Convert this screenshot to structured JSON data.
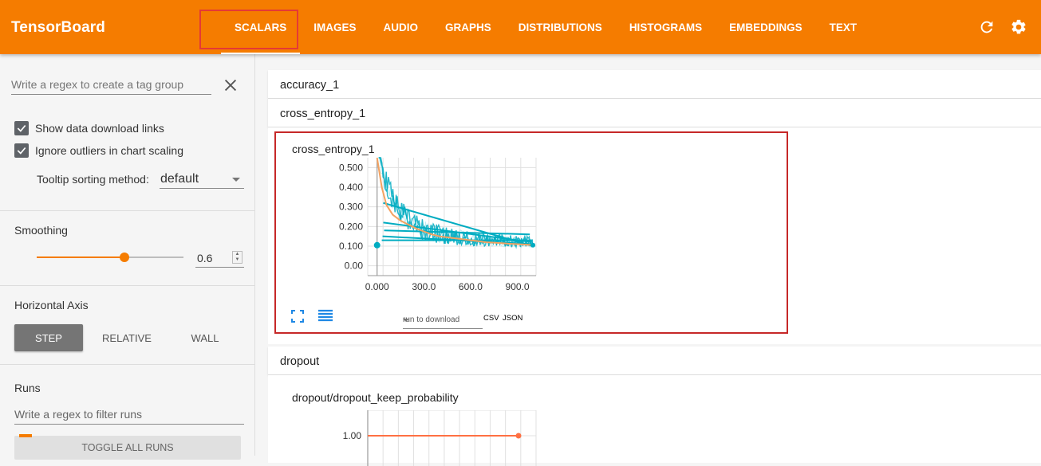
{
  "app": {
    "title": "TensorBoard"
  },
  "tabs": [
    {
      "label": "SCALARS",
      "active": true
    },
    {
      "label": "IMAGES"
    },
    {
      "label": "AUDIO"
    },
    {
      "label": "GRAPHS"
    },
    {
      "label": "DISTRIBUTIONS"
    },
    {
      "label": "HISTOGRAMS"
    },
    {
      "label": "EMBEDDINGS"
    },
    {
      "label": "TEXT"
    }
  ],
  "toolbar_icons": [
    "reload-icon",
    "settings-icon"
  ],
  "sidebar": {
    "tag_group_placeholder": "Write a regex to create a tag group",
    "show_download_links": "Show data download links",
    "ignore_outliers": "Ignore outliers in chart scaling",
    "tooltip_label": "Tooltip sorting method:",
    "tooltip_value": "default",
    "smoothing_title": "Smoothing",
    "smoothing_value": "0.6",
    "smoothing_fraction": 0.6,
    "horizontal_axis_title": "Horizontal Axis",
    "axis_options": [
      "STEP",
      "RELATIVE",
      "WALL"
    ],
    "axis_selected": "STEP",
    "runs_title": "Runs",
    "runs_placeholder": "Write a regex to filter runs",
    "toggle_all_runs": "TOGGLE ALL RUNS"
  },
  "main": {
    "categories": [
      "accuracy_1",
      "cross_entropy_1",
      "dropout"
    ],
    "card1": {
      "title": "cross_entropy_1",
      "download_select": "run to download",
      "csv": "CSV",
      "json": "JSON"
    },
    "card2": {
      "title": "dropout/dropout_keep_probability"
    }
  },
  "colors": {
    "accent": "#f57c00",
    "raw_series": "#00acc1",
    "smoothed_series": "#f4a261",
    "annotation": "#d32f2f"
  },
  "chart_data": [
    {
      "type": "line",
      "title": "cross_entropy_1",
      "x_ticks": [
        "0.000",
        "300.0",
        "600.0",
        "900.0"
      ],
      "y_ticks": [
        "0.00",
        "0.100",
        "0.200",
        "0.300",
        "0.400",
        "0.500"
      ],
      "xlim": [
        -60,
        1020
      ],
      "ylim": [
        -0.05,
        0.55
      ],
      "series": [
        {
          "x": [
            0,
            30,
            60,
            100,
            150,
            200,
            250,
            300,
            350,
            400,
            450,
            500,
            550,
            600,
            650,
            700,
            750,
            800,
            850,
            900,
            950,
            1000
          ],
          "values": [
            0.55,
            0.4,
            0.31,
            0.26,
            0.23,
            0.21,
            0.19,
            0.175,
            0.16,
            0.15,
            0.145,
            0.14,
            0.135,
            0.13,
            0.125,
            0.12,
            0.118,
            0.115,
            0.112,
            0.11,
            0.108,
            0.105
          ]
        }
      ]
    },
    {
      "type": "line",
      "title": "dropout/dropout_keep_probability",
      "y_ticks": [
        "1.00"
      ],
      "series": [
        {
          "x": [
            0,
            1000
          ],
          "values": [
            1.0,
            1.0
          ]
        }
      ]
    }
  ]
}
